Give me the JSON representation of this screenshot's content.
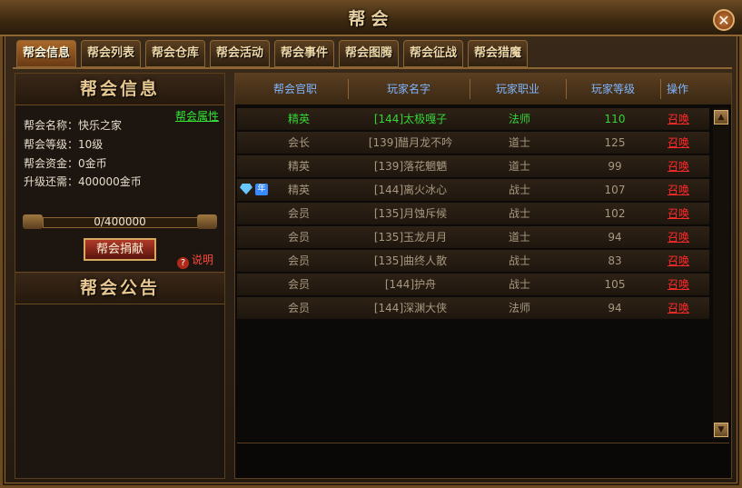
{
  "window": {
    "title": "帮会",
    "close_label": "✕"
  },
  "tabs": [
    {
      "label": "帮会信息"
    },
    {
      "label": "帮会列表"
    },
    {
      "label": "帮会仓库"
    },
    {
      "label": "帮会活动"
    },
    {
      "label": "帮会事件"
    },
    {
      "label": "帮会图腾"
    },
    {
      "label": "帮会征战"
    },
    {
      "label": "帮会猎魔"
    }
  ],
  "guild_info": {
    "header": "帮会信息",
    "attr_link": "帮会属性",
    "name_line": "帮会名称：快乐之家",
    "level_line": "帮会等级：10级",
    "funds_line": "帮会资金：0金币",
    "upgrade_line": "升级还需：400000金币",
    "progress_text": "0/400000",
    "progress_fraction": 0,
    "donate_label": "帮会捐献",
    "help_label": "说明"
  },
  "notice": {
    "header": "帮会公告"
  },
  "member_table": {
    "headers": [
      "帮会官职",
      "玩家名字",
      "玩家职业",
      "玩家等级",
      "操作"
    ],
    "rows": [
      {
        "rank": "精英",
        "name": "[144]太极嘎子",
        "job": "法师",
        "level": "110",
        "action": "召唤"
      },
      {
        "rank": "会长",
        "name": "[139]醋月龙不吟",
        "job": "道士",
        "level": "125",
        "action": "召唤"
      },
      {
        "rank": "精英",
        "name": "[139]落花魍魉",
        "job": "道士",
        "level": "99",
        "action": "召唤"
      },
      {
        "rank": "精英",
        "name": "[144]离火冰心",
        "job": "战士",
        "level": "107",
        "action": "召唤"
      },
      {
        "rank": "会员",
        "name": "[135]月蚀斥候",
        "job": "战士",
        "level": "102",
        "action": "召唤"
      },
      {
        "rank": "会员",
        "name": "[135]玉龙月月",
        "job": "道士",
        "level": "94",
        "action": "召唤"
      },
      {
        "rank": "会员",
        "name": "[135]曲终人散",
        "job": "战士",
        "level": "83",
        "action": "召唤"
      },
      {
        "rank": "会员",
        "name": "[144]护舟",
        "job": "战士",
        "level": "105",
        "action": "召唤"
      },
      {
        "rank": "会员",
        "name": "[144]深渊大侠",
        "job": "法师",
        "level": "94",
        "action": "召唤"
      }
    ],
    "vip_badge_text": "年"
  },
  "colors": {
    "accent": "#8c6532",
    "online": "#35d535",
    "link_red": "#ff2a2a",
    "header_blue": "#7fb6ff"
  },
  "icons": {
    "close": "close-icon",
    "help": "question-icon",
    "vip_gem": "diamond-icon",
    "scroll_up": "arrow-up-icon",
    "scroll_down": "arrow-down-icon"
  }
}
